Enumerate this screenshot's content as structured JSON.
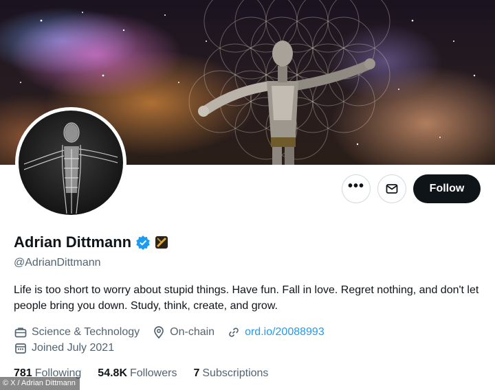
{
  "profile": {
    "display_name": "Adrian Dittmann",
    "handle": "@AdrianDittmann",
    "bio": "Life is too short to worry about stupid things. Have fun. Fall in love. Regret nothing, and don't let people bring you down. Study, think, create, and grow.",
    "category": "Science & Technology",
    "location": "On-chain",
    "website": "ord.io/20088993",
    "joined": "Joined July 2021"
  },
  "actions": {
    "more_label": "•••",
    "follow_label": "Follow"
  },
  "stats": {
    "following_count": "781",
    "following_label": "Following",
    "followers_count": "54.8K",
    "followers_label": "Followers",
    "subscriptions_count": "7",
    "subscriptions_label": "Subscriptions"
  },
  "credit": "© X / Adrian Dittmann",
  "icons": {
    "more": "more-icon",
    "message": "mail-icon",
    "verified": "verified-badge-icon",
    "affiliate": "affiliate-badge-icon",
    "category": "briefcase-icon",
    "location": "location-pin-icon",
    "link": "link-icon",
    "joined": "calendar-icon"
  },
  "colors": {
    "follow_button_bg": "#0f1419",
    "verified_blue": "#1d9bf0",
    "link_blue": "#1d9bf0",
    "secondary_text": "#536471"
  }
}
